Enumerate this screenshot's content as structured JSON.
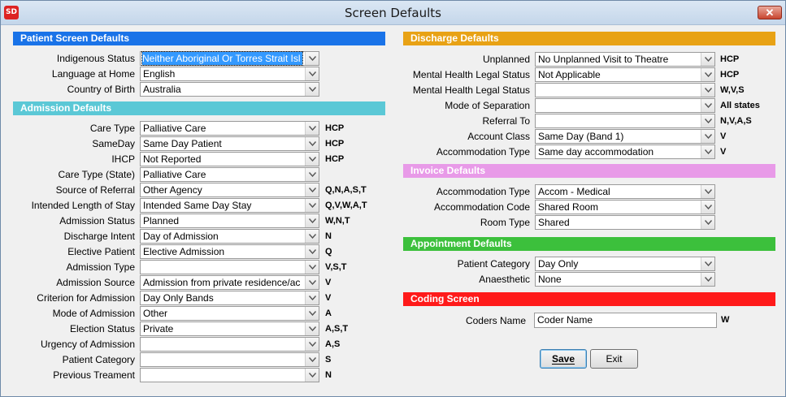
{
  "window": {
    "title": "Screen Defaults",
    "app_icon_text": "SD",
    "close_glyph": "✕"
  },
  "colors": {
    "patient_header": "#1a73e8",
    "admission_header": "#5bc8d6",
    "discharge_header": "#e8a215",
    "invoice_header": "#e89ae8",
    "appointment_header": "#3cc03c",
    "coding_header": "#ff1a1a"
  },
  "patient": {
    "header": "Patient Screen Defaults",
    "fields": [
      {
        "label": "Indigenous Status",
        "value": "Neither Aboriginal Or Torres Strait Isl",
        "states": ""
      },
      {
        "label": "Language at Home",
        "value": "English",
        "states": ""
      },
      {
        "label": "Country of Birth",
        "value": "Australia",
        "states": ""
      }
    ]
  },
  "admission": {
    "header": "Admission Defaults",
    "fields": [
      {
        "label": "Care Type",
        "value": "Palliative Care",
        "states": "HCP"
      },
      {
        "label": "SameDay",
        "value": "Same Day Patient",
        "states": "HCP"
      },
      {
        "label": "IHCP",
        "value": "Not Reported",
        "states": "HCP"
      },
      {
        "label": "Care Type (State)",
        "value": "Palliative Care",
        "states": ""
      },
      {
        "label": "Source of Referral",
        "value": "Other Agency",
        "states": "Q,N,A,S,T"
      },
      {
        "label": "Intended Length of Stay",
        "value": "Intended Same Day Stay",
        "states": "Q,V,W,A,T"
      },
      {
        "label": "Admission Status",
        "value": "Planned",
        "states": "W,N,T"
      },
      {
        "label": "Discharge Intent",
        "value": "Day of Admission",
        "states": "N"
      },
      {
        "label": "Elective Patient",
        "value": "Elective Admission",
        "states": "Q"
      },
      {
        "label": "Admission Type",
        "value": "",
        "states": "V,S,T"
      },
      {
        "label": "Admission Source",
        "value": "Admission from private residence/ac",
        "states": "V"
      },
      {
        "label": "Criterion for Admission",
        "value": "Day Only Bands",
        "states": "V"
      },
      {
        "label": "Mode of Admission",
        "value": "Other",
        "states": "A"
      },
      {
        "label": "Election Status",
        "value": "Private",
        "states": "A,S,T"
      },
      {
        "label": "Urgency of Admission",
        "value": "",
        "states": "A,S"
      },
      {
        "label": "Patient Category",
        "value": "",
        "states": "S"
      },
      {
        "label": "Previous Treament",
        "value": "",
        "states": "N"
      }
    ]
  },
  "discharge": {
    "header": "Discharge Defaults",
    "fields": [
      {
        "label": "Unplanned",
        "value": "No Unplanned Visit to Theatre",
        "states": "HCP"
      },
      {
        "label": "Mental Health Legal Status",
        "value": "Not Applicable",
        "states": "HCP"
      },
      {
        "label": "Mental Health Legal Status",
        "value": "",
        "states": "W,V,S"
      },
      {
        "label": "Mode of Separation",
        "value": "",
        "states": "All states"
      },
      {
        "label": "Referral To",
        "value": "",
        "states": "N,V,A,S"
      },
      {
        "label": "Account Class",
        "value": "Same Day (Band 1)",
        "states": "V"
      },
      {
        "label": "Accommodation Type",
        "value": "Same day accommodation",
        "states": "V"
      }
    ]
  },
  "invoice": {
    "header": "Invoice Defaults",
    "fields": [
      {
        "label": "Accommodation Type",
        "value": "Accom - Medical",
        "states": ""
      },
      {
        "label": "Accommodation Code",
        "value": "Shared Room",
        "states": ""
      },
      {
        "label": "Room Type",
        "value": "Shared",
        "states": ""
      }
    ]
  },
  "appointment": {
    "header": "Appointment Defaults",
    "fields": [
      {
        "label": "Patient Category",
        "value": "Day Only",
        "states": ""
      },
      {
        "label": "Anaesthetic",
        "value": "None",
        "states": ""
      }
    ]
  },
  "coding": {
    "header": "Coding Screen",
    "coders_name_label": "Coders Name",
    "coders_name_value": "Coder Name",
    "coders_name_states": "W"
  },
  "buttons": {
    "save": "Save",
    "exit": "Exit"
  }
}
